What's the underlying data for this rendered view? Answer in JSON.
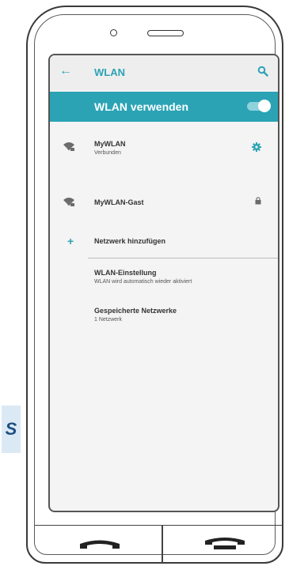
{
  "app_bar": {
    "title": "WLAN",
    "back_icon": "arrow-left-icon",
    "search_icon": "search-icon"
  },
  "wlan_toggle": {
    "label": "WLAN verwenden",
    "enabled": true
  },
  "networks": [
    {
      "name": "MyWLAN",
      "status": "Verbunden",
      "trailing_icon": "gear-icon"
    },
    {
      "name": "MyWLAN-Gast",
      "status": "",
      "trailing_icon": "lock-icon"
    }
  ],
  "add_network": {
    "label": "Netzwerk hinzufügen"
  },
  "settings": [
    {
      "title": "WLAN-Einstellung",
      "subtitle": "WLAN wird automatisch wieder aktiviert"
    },
    {
      "title": "Gespeicherte Netzwerke",
      "subtitle": "1 Netzwerk"
    }
  ],
  "side_tab": {
    "letter": "S"
  },
  "colors": {
    "accent": "#2ba3b5",
    "screen_bg": "#f4f4f4"
  }
}
